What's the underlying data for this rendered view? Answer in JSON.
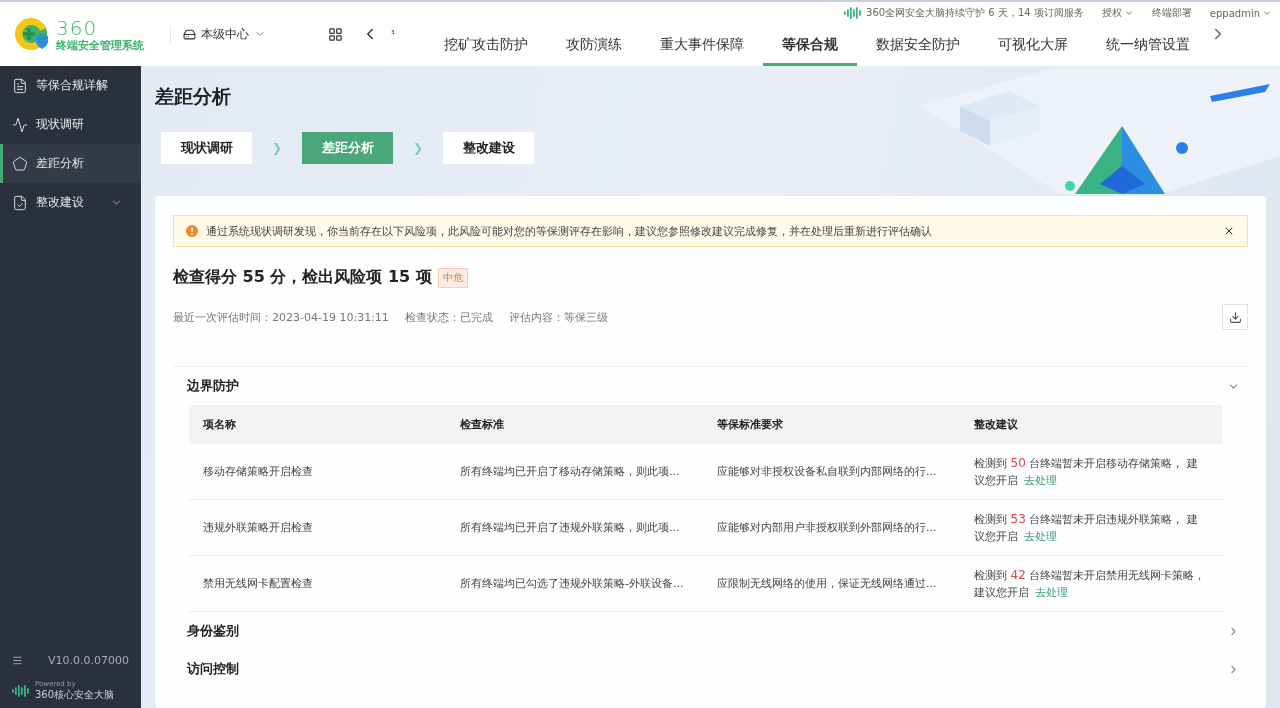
{
  "header": {
    "logo": {
      "brand": "360",
      "subtitle": "终端安全管理系统"
    },
    "center_select": "本级中心",
    "nav_prev_mark": "³",
    "nav_items": [
      {
        "label": "挖矿攻击防护",
        "selected": false
      },
      {
        "label": "攻防演练",
        "selected": false
      },
      {
        "label": "重大事件保障",
        "selected": false
      },
      {
        "label": "等保合规",
        "selected": true
      },
      {
        "label": "数据安全防护",
        "selected": false
      },
      {
        "label": "可视化大屏",
        "selected": false
      },
      {
        "label": "统一纳管设置",
        "selected": false
      }
    ],
    "status": "360全网安全大脑持续守护 6 天，14 项订阅服务",
    "links": [
      {
        "label": "授权",
        "dropdown": true
      },
      {
        "label": "终端部署",
        "dropdown": false
      },
      {
        "label": "eppadmin",
        "dropdown": true
      }
    ]
  },
  "sidebar": {
    "items": [
      {
        "label": "等保合规详解",
        "selected": false,
        "expandable": false
      },
      {
        "label": "现状调研",
        "selected": false,
        "expandable": false
      },
      {
        "label": "差距分析",
        "selected": true,
        "expandable": false
      },
      {
        "label": "整改建设",
        "selected": false,
        "expandable": true
      }
    ],
    "version": "V10.0.0.07000",
    "powered_by": "Powered by",
    "powered_brand": "360核心安全大脑"
  },
  "page": {
    "title": "差距分析",
    "steps": [
      {
        "label": "现状调研",
        "selected": false
      },
      {
        "label": "差距分析",
        "selected": true
      },
      {
        "label": "整改建设",
        "selected": false
      }
    ],
    "step_separator": "❯",
    "alert": "通过系统现状调研发现，你当前存在以下风险项，此风险可能对您的等保测评存在影响，建议您参照修改建议完成修复，并在处理后重新进行评估确认",
    "score_heading": "检查得分 55 分，检出风险项 15 项",
    "risk_badge": "中危",
    "meta": [
      "最近一次评估时间：2023-04-19 10:31:11",
      "检查状态：已完成",
      "评估内容：等保三级"
    ],
    "sections": [
      {
        "title": "边界防护",
        "expanded": true,
        "table": {
          "columns": [
            "项名称",
            "检查标准",
            "等保标准要求",
            "整改建议"
          ],
          "rows": [
            {
              "name": "移动存储策略开启检查",
              "standard": "所有终端均已开启了移动存储策略，则此项...",
              "requirement": "应能够对非授权设备私自联到内部网络的行...",
              "advice_prefix": "检测到",
              "count": "50",
              "advice_suffix": "台终端暂未开启移动存储策略， 建议您开启",
              "action": "去处理"
            },
            {
              "name": "违规外联策略开启检查",
              "standard": "所有终端均已开启了违规外联策略，则此项...",
              "requirement": "应能够对内部用户非授权联到外部网络的行...",
              "advice_prefix": "检测到",
              "count": "53",
              "advice_suffix": "台终端暂未开启违规外联策略， 建议您开启",
              "action": "去处理"
            },
            {
              "name": "禁用无线网卡配置检查",
              "standard": "所有终端均已勾选了违规外联策略-外联设备...",
              "requirement": "应限制无线网络的使用，保证无线网络通过...",
              "advice_prefix": "检测到",
              "count": "42",
              "advice_suffix": "台终端暂未开启禁用无线网卡策略，建议您开启",
              "action": "去处理"
            }
          ]
        }
      },
      {
        "title": "身份鉴别",
        "expanded": false
      },
      {
        "title": "访问控制",
        "expanded": false
      }
    ]
  }
}
